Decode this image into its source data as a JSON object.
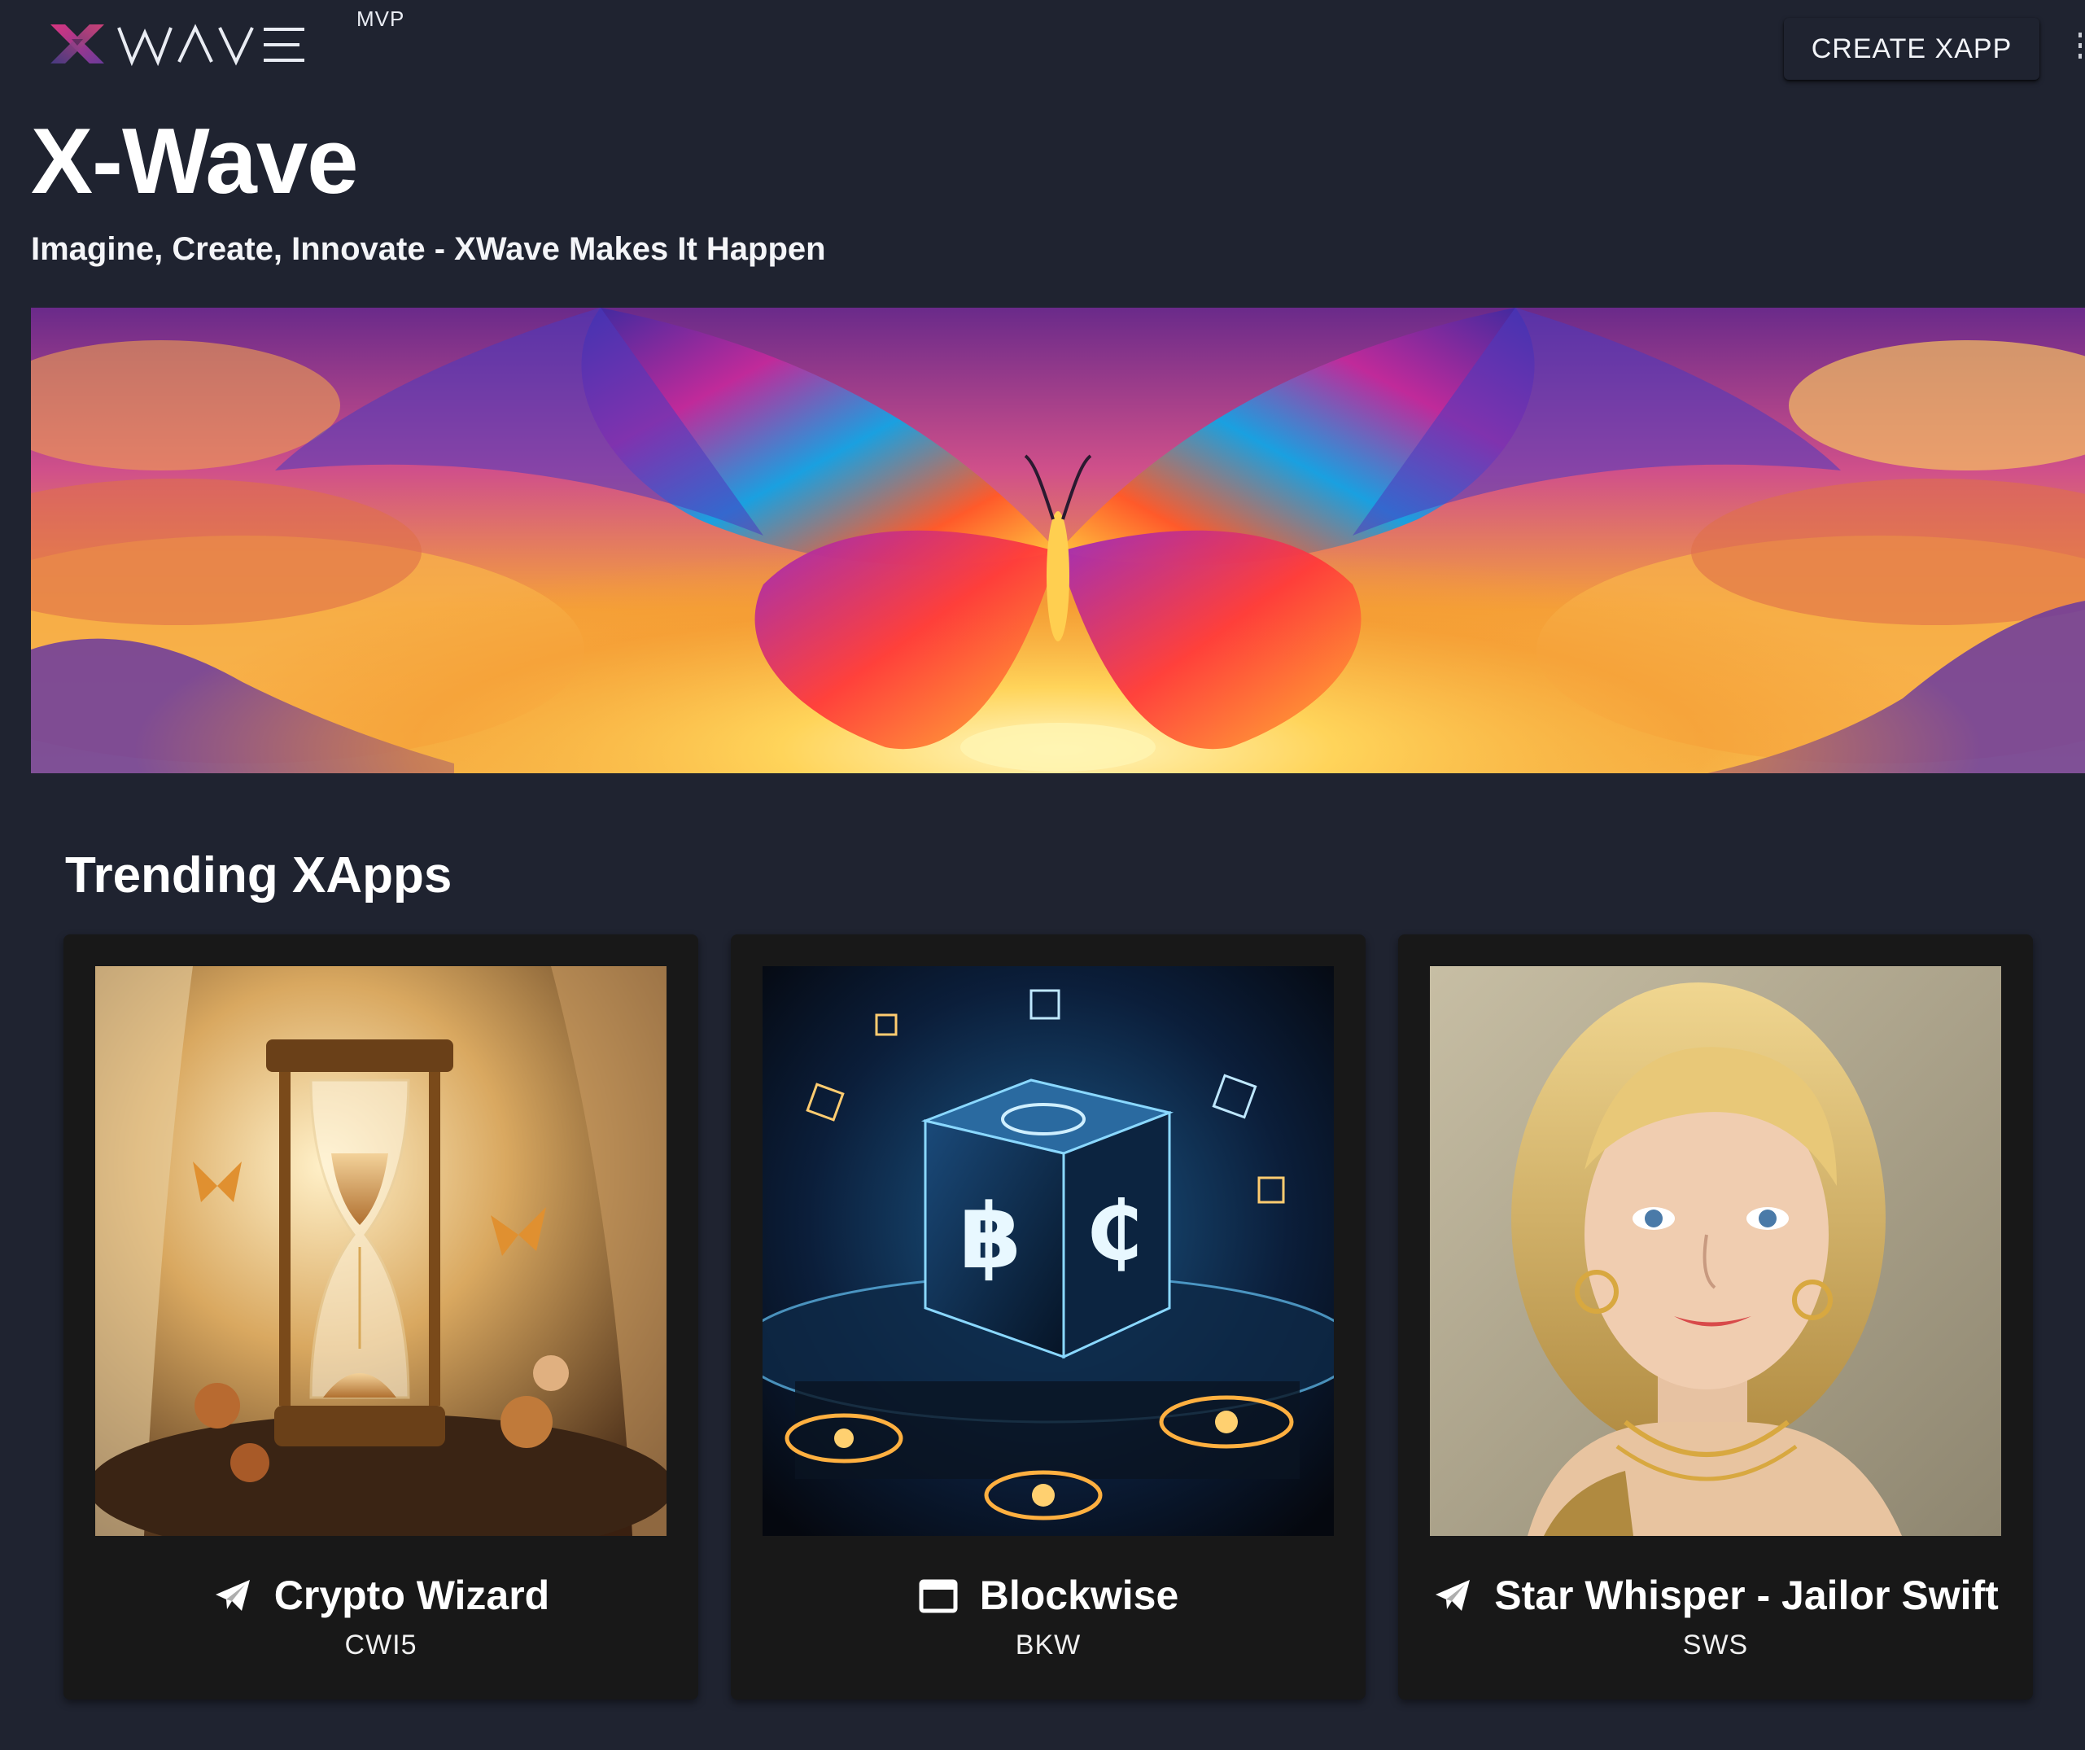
{
  "header": {
    "logo_text": "WAVE",
    "logo_mark": "X",
    "badge": "MVP",
    "create_button": "CREATE XAPP"
  },
  "hero": {
    "title": "X-Wave",
    "tagline": "Imagine, Create, Innovate - XWave Makes It Happen",
    "banner_image": "rainbow butterfly wings over sunset clouds"
  },
  "trending": {
    "title": "Trending XApps",
    "cards": [
      {
        "name": "Crypto Wizard",
        "symbol": "CWI5",
        "icon": "telegram-send-icon",
        "image": "ornate hourglass with butterflies and roses"
      },
      {
        "name": "Blockwise",
        "symbol": "BKW",
        "icon": "browser-window-icon",
        "image": "glowing blockchain cube with crypto symbols"
      },
      {
        "name": "Star Whisper - Jailor Swift",
        "symbol": "SWS",
        "icon": "telegram-send-icon",
        "image": "painted portrait of a blonde woman with gold jewelry"
      }
    ]
  },
  "colors": {
    "page_background": "#1f2330",
    "card_background": "#181818",
    "logo_magenta": "#c0327a",
    "logo_purple": "#5a3a8a",
    "text": "#ffffff"
  }
}
